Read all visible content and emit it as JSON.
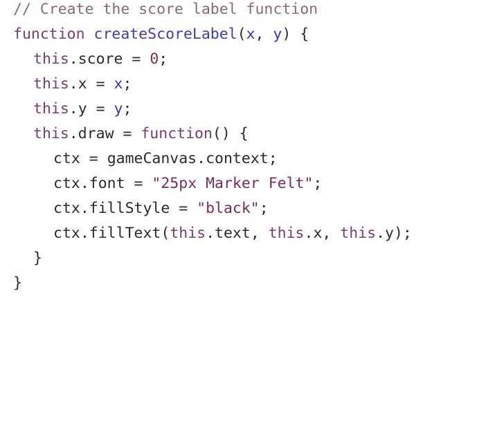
{
  "code": {
    "comment": "// Create the score label function",
    "kw_function": "function",
    "fn_name": "createScoreLabel",
    "param_x": "x",
    "param_y": "y",
    "this": "this",
    "prop_score": "score",
    "num_zero": "0",
    "prop_x": "x",
    "prop_y": "y",
    "prop_draw": "draw",
    "ctx": "ctx",
    "gameCanvas_context": "gameCanvas.context",
    "prop_font": "font",
    "str_font": "\"25px Marker Felt\"",
    "prop_fillStyle": "fillStyle",
    "str_black": "\"black\"",
    "prop_fillText": "fillText",
    "prop_text": "text",
    "close_brace": "}"
  }
}
